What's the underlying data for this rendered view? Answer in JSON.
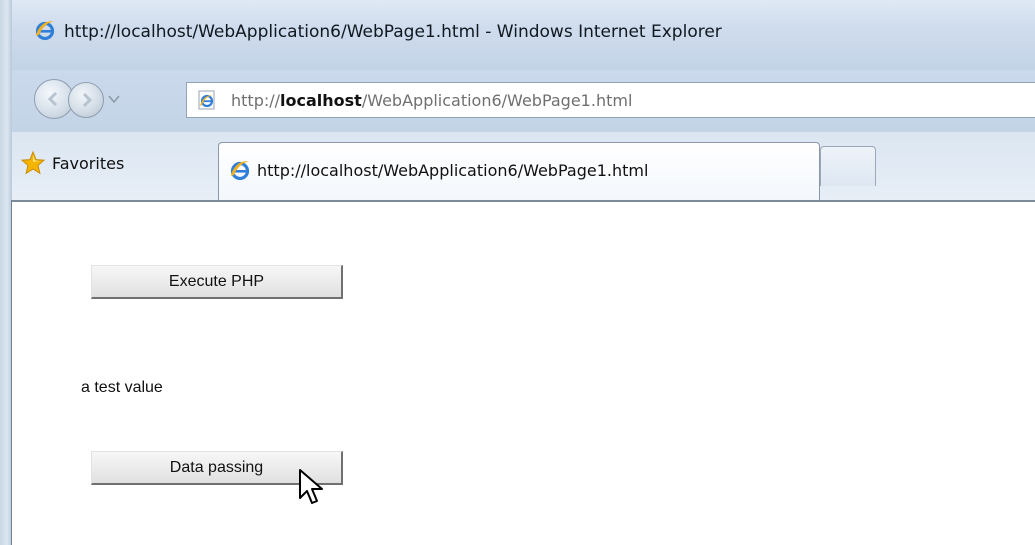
{
  "window": {
    "title": "http://localhost/WebApplication6/WebPage1.html - Windows Internet Explorer"
  },
  "address_bar": {
    "prefix": "http://",
    "host": "localhost",
    "path": "/WebApplication6/WebPage1.html"
  },
  "favorites": {
    "label": "Favorites"
  },
  "tabs": [
    {
      "label": "http://localhost/WebApplication6/WebPage1.html",
      "active": true
    }
  ],
  "page": {
    "execute_button_label": "Execute PHP",
    "result_text": "a test value",
    "data_passing_button_label": "Data passing"
  },
  "icons": {
    "title": "ie-logo-icon",
    "back": "back-arrow-icon",
    "forward": "forward-arrow-icon",
    "address": "ie-page-icon",
    "favorites": "favorites-star-icon",
    "tab": "ie-logo-icon",
    "cursor": "mouse-pointer-icon"
  },
  "colors": {
    "chrome_blue": "#c8d8ea",
    "ie_blue": "#2f7fd8",
    "ie_gold": "#f0b020",
    "star_gold": "#f5b400"
  }
}
